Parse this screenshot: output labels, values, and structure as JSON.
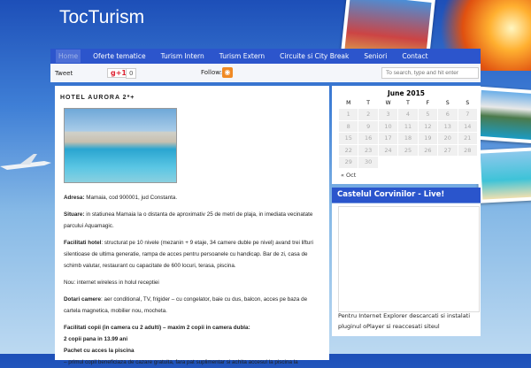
{
  "site": {
    "title": "TocTurism"
  },
  "nav": {
    "items": [
      "Home",
      "Oferte tematice",
      "Turism Intern",
      "Turism Extern",
      "Circuite si City Break",
      "Seniori",
      "Contact"
    ]
  },
  "social": {
    "tweet": "Tweet",
    "gplus": "g+1",
    "gplus_count": "0",
    "follow": "Follow:",
    "search_placeholder": "To search, type and hit enter"
  },
  "post": {
    "title": "HOTEL AURORA 2*+",
    "paragraphs": [
      {
        "label": "Adresa:",
        "text": " Mamaia, cod 900001, jud Constanta."
      },
      {
        "label": "Situare:",
        "text": " in statiunea Mamaia la o distanta de aproximativ 25 de metri de plaja, in imediata vecinatate parcului Aquamagic."
      },
      {
        "label": "Facilitati hotel",
        "text": ": structurat pe 10 nivele (mezanin + 9 etaje, 34 camere duble pe nivel) avand  trei lifturi silentioase de ultima generatie, rampa de acces pentru persoanele cu handicap. Bar de zi, casa de schimb valutar, restaurant cu capacitate de 600 locuri, terasa, piscina."
      },
      {
        "label": "",
        "text": "Nou: internet wireless in holul receptiei"
      },
      {
        "label": "Dotari camere",
        "text": ": aer conditional, TV, frigider – cu congelator, baie cu dus, balcon, acces pe baza de cartela magnetica, mobilier nou, mocheta."
      }
    ],
    "kids_title": "Facilitati copii (in camera cu 2 adulti) – maxim 2 copii in camera dubla:",
    "kids_age": "2 copii pana in 13.99 ani",
    "kids_pack": "Pachet cu acces la piscina",
    "kids_text": "– primul copil beneficiaza de cazare gratuita, fara pat suplimentar si achita accesul la piscina la"
  },
  "calendar": {
    "caption": "June 2015",
    "days": [
      "M",
      "T",
      "W",
      "T",
      "F",
      "S",
      "S"
    ],
    "weeks": [
      [
        "1",
        "2",
        "3",
        "4",
        "5",
        "6",
        "7"
      ],
      [
        "8",
        "9",
        "10",
        "11",
        "12",
        "13",
        "14"
      ],
      [
        "15",
        "16",
        "17",
        "18",
        "19",
        "20",
        "21"
      ],
      [
        "22",
        "23",
        "24",
        "25",
        "26",
        "27",
        "28"
      ],
      [
        "29",
        "30",
        "",
        "",
        "",
        "",
        ""
      ]
    ],
    "prev": "« Oct"
  },
  "widget": {
    "title": "Castelul Corvinilor - Live!",
    "text": "Pentru Internet Explorer descarcati si instalati pluginul oPlayer si reaccesati siteul"
  }
}
